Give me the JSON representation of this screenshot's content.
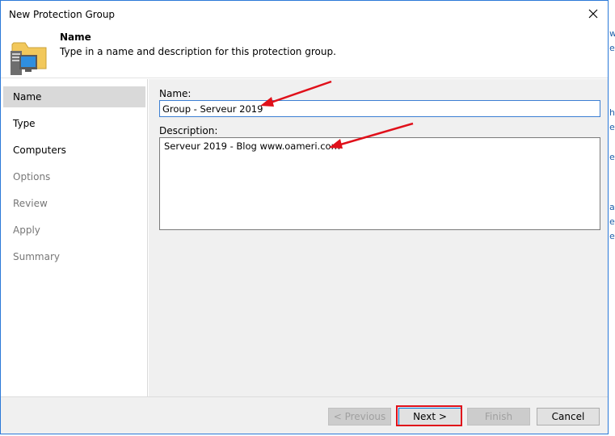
{
  "window": {
    "title": "New Protection Group"
  },
  "header": {
    "title": "Name",
    "description": "Type in a name and description for this protection group.",
    "icon": "protection-group-folder-icon"
  },
  "sidebar": {
    "items": [
      {
        "label": "Name",
        "state": "active"
      },
      {
        "label": "Type",
        "state": "enabled"
      },
      {
        "label": "Computers",
        "state": "enabled"
      },
      {
        "label": "Options",
        "state": "disabled"
      },
      {
        "label": "Review",
        "state": "disabled"
      },
      {
        "label": "Apply",
        "state": "disabled"
      },
      {
        "label": "Summary",
        "state": "disabled"
      }
    ]
  },
  "form": {
    "name_label": "Name:",
    "name_value": "Group - Serveur 2019",
    "description_label": "Description:",
    "description_value": "Serveur 2019 - Blog www.oameri.com"
  },
  "footer": {
    "previous_label": "< Previous",
    "next_label": "Next >",
    "finish_label": "Finish",
    "cancel_label": "Cancel"
  },
  "colors": {
    "annotation_arrow": "#e0101a",
    "active_nav": "#d9d9d9",
    "window_border": "#2b79d8"
  }
}
